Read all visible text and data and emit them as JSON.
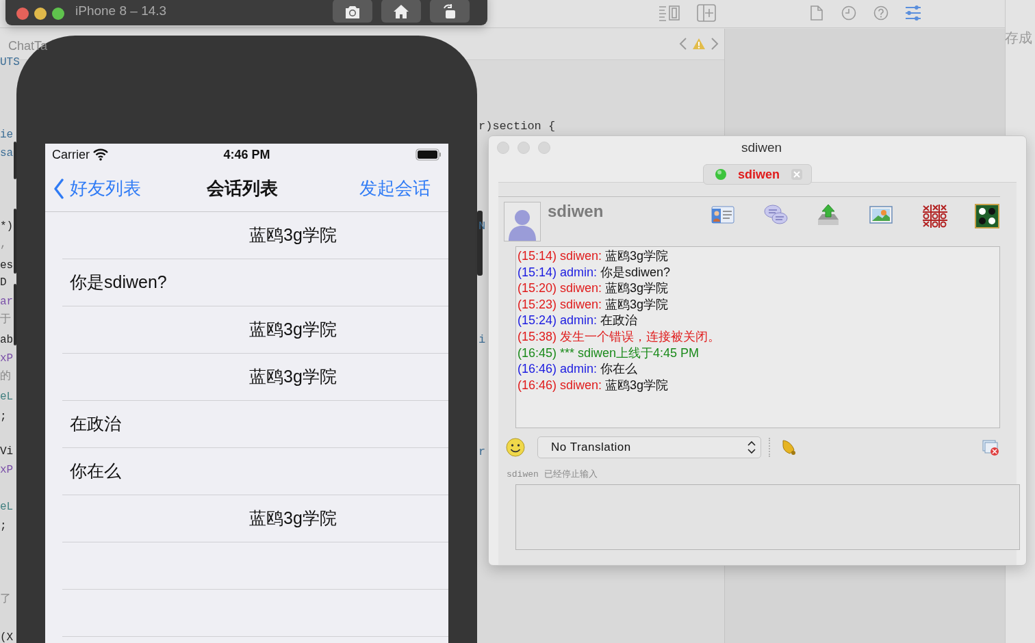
{
  "editor": {
    "tab_label": "ChatTa",
    "side_text": "存成",
    "code_fragments": [
      {
        "text": "UTS",
        "color": "#3d6e96"
      },
      {
        "text": "ie",
        "color": "#3d6e96"
      },
      {
        "text": "sa",
        "color": "#3d6e96"
      },
      {
        "text": "*)",
        "color": "#222222"
      },
      {
        "text": ",",
        "color": "#888888"
      },
      {
        "text": "es",
        "color": "#222222"
      },
      {
        "text": "D",
        "color": "#222222"
      },
      {
        "text": "ar",
        "color": "#7a4fa8"
      },
      {
        "text": "于",
        "color": "#888888"
      },
      {
        "text": "ab",
        "color": "#222222"
      },
      {
        "text": "xP",
        "color": "#7a4fa8"
      },
      {
        "text": "的",
        "color": "#888888"
      },
      {
        "text": "eL",
        "color": "#3f7f7f"
      },
      {
        "text": ";",
        "color": "#222222"
      },
      {
        "text": "Vi",
        "color": "#222222"
      },
      {
        "text": "xP",
        "color": "#7a4fa8"
      },
      {
        "text": "eL",
        "color": "#3f7f7f"
      },
      {
        "text": ";",
        "color": "#222222"
      },
      {
        "text": "了",
        "color": "#888888"
      },
      {
        "text": "(X",
        "color": "#222222"
      }
    ],
    "right_fragments": [
      {
        "text": "r)section {",
        "color": "#333333"
      },
      {
        "text": "N",
        "color": "#3d6e96"
      },
      {
        "text": "i",
        "color": "#3d6e96"
      },
      {
        "text": "r",
        "color": "#3d6e96"
      }
    ]
  },
  "simulator": {
    "title": "iPhone 8 – 14.3"
  },
  "phone": {
    "carrier": "Carrier",
    "time": "4:46 PM",
    "nav": {
      "back": "好友列表",
      "title": "会话列表",
      "action": "发起会话"
    },
    "rows": [
      {
        "text": "蓝鸥3g学院",
        "kind": "sent"
      },
      {
        "text": "你是sdiwen?",
        "kind": "received"
      },
      {
        "text": "蓝鸥3g学院",
        "kind": "sent"
      },
      {
        "text": "蓝鸥3g学院",
        "kind": "sent"
      },
      {
        "text": "在政治",
        "kind": "received"
      },
      {
        "text": "你在么",
        "kind": "received"
      },
      {
        "text": "蓝鸥3g学院",
        "kind": "sent"
      }
    ]
  },
  "chat_window": {
    "title": "sdiwen",
    "tab": {
      "label": "sdiwen",
      "online": true
    },
    "contact_name": "sdiwen",
    "messages": [
      {
        "kind": "message",
        "time": "(15:14)",
        "sender": "sdiwen:",
        "text": "蓝鸥3g学院",
        "color": "#e01b1b"
      },
      {
        "kind": "message",
        "time": "(15:14)",
        "sender": "admin:",
        "text": "你是sdiwen?",
        "color": "#1b1be0"
      },
      {
        "kind": "message",
        "time": "(15:20)",
        "sender": "sdiwen:",
        "text": "蓝鸥3g学院",
        "color": "#e01b1b"
      },
      {
        "kind": "message",
        "time": "(15:23)",
        "sender": "sdiwen:",
        "text": "蓝鸥3g学院",
        "color": "#e01b1b"
      },
      {
        "kind": "message",
        "time": "(15:24)",
        "sender": "admin:",
        "text": "在政治",
        "color": "#1b1be0"
      },
      {
        "kind": "notice",
        "time": "(15:38)",
        "text": "发生一个错误，连接被关闭。",
        "color": "#e01b1b"
      },
      {
        "kind": "notice",
        "time": "(16:45)",
        "text": "*** sdiwen上线于4:45 PM",
        "color": "#1a8a1a"
      },
      {
        "kind": "message",
        "time": "(16:46)",
        "sender": "admin:",
        "text": "你在么",
        "color": "#1b1be0"
      },
      {
        "kind": "message",
        "time": "(16:46)",
        "sender": "sdiwen:",
        "text": "蓝鸥3g学院",
        "color": "#e01b1b"
      }
    ],
    "translation": "No Translation",
    "typing_status": "sdiwen 已经停止输入"
  }
}
